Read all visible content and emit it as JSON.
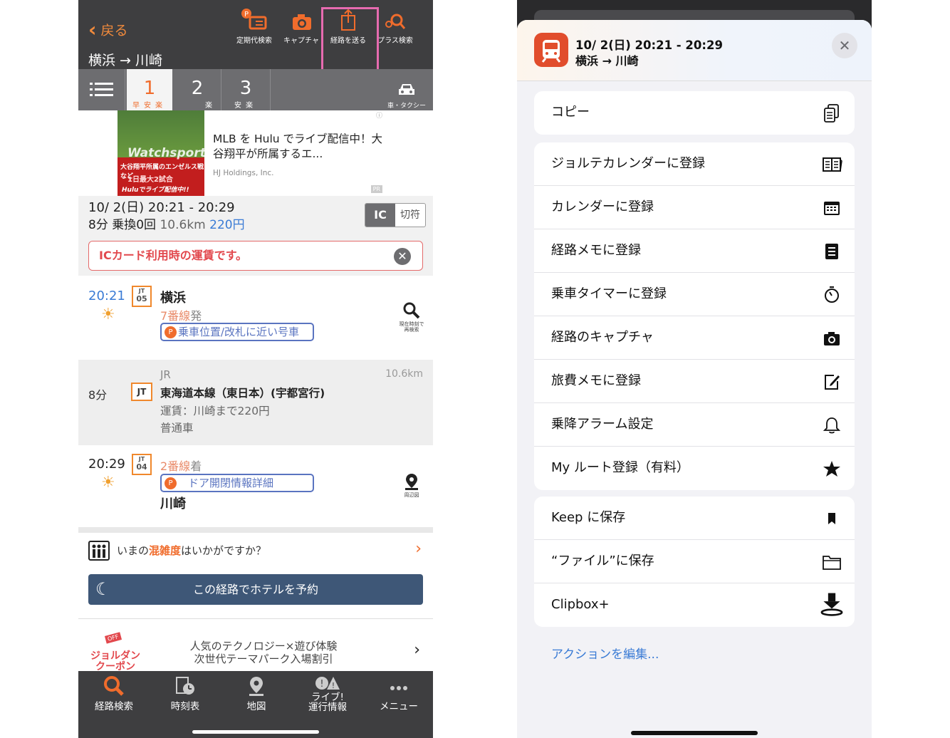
{
  "left": {
    "header": {
      "back_label": "戻る",
      "route_title": "横浜 → 川崎",
      "tools": [
        {
          "label": "定期代検索",
          "icon": "commuter-pass-icon"
        },
        {
          "label": "キャプチャ",
          "icon": "camera-icon"
        },
        {
          "label": "経路を送る",
          "icon": "share-icon"
        },
        {
          "label": "プラス検索",
          "icon": "plus-search-icon"
        }
      ]
    },
    "tabs": [
      {
        "num": "1",
        "sub": "早安楽"
      },
      {
        "num": "2",
        "sub": "楽"
      },
      {
        "num": "3",
        "sub": "安楽"
      },
      {
        "num": "",
        "sub": "車・タクシー"
      }
    ],
    "ad": {
      "image_text_1": "Watchsports!!",
      "image_text_2": "大谷翔平所属のエンゼルス戦など",
      "image_text_3": "1日最大2試合",
      "image_text_4": "Huluでライブ配信中!!",
      "headline": "MLB を Hulu でライブ配信中！大谷翔平が所属するエ...",
      "source": "HJ Holdings, Inc.",
      "pr": "PR",
      "info": "ⓘ"
    },
    "summary": {
      "datetime": "10/ 2(日) 20:21 - 20:29",
      "duration": "8分",
      "transfers": "乗換0回",
      "distance": "10.6km",
      "fare": "220円",
      "toggle_on": "IC",
      "toggle_off": "切符",
      "notice": "ICカード利用時の運賃です。"
    },
    "route": {
      "depart_time": "20:21",
      "depart_station": "横浜",
      "depart_code": "JT",
      "depart_num": "05",
      "depart_platform": "7番線",
      "depart_suffix": "発",
      "depart_pill": "乗車位置/改札に近い号車",
      "research_label": "現在時刻で再検索",
      "leg_duration": "8分",
      "leg_company": "JR",
      "leg_distance": "10.6km",
      "leg_badge": "JT",
      "leg_line": "東海道本線（東日本）(宇都宮行)",
      "leg_fare": "運賃：川崎まで220円",
      "leg_car": "普通車",
      "arrive_time": "20:29",
      "arrive_code": "JT",
      "arrive_num": "04",
      "arrive_platform": "2番線",
      "arrive_suffix": "着",
      "arrive_pill": "ドア開閉情報詳細",
      "arrive_station": "川崎",
      "map_label": "周辺図"
    },
    "crowd": {
      "prefix": "いまの",
      "highlight": "混雑度",
      "suffix": "はいかがですか？"
    },
    "hotel": "この経路でホテルを予約",
    "coupon": {
      "badge": "OFF",
      "label_1": "ジョルダン",
      "label_2": "クーポン",
      "line_1": "人気のテクノロジー×遊び体験",
      "line_2": "次世代テーマパーク入場割引"
    },
    "nav": [
      {
        "label": "経路検索",
        "icon": "route-search-icon"
      },
      {
        "label": "時刻表",
        "icon": "timetable-icon"
      },
      {
        "label": "地図",
        "icon": "map-pin-icon"
      },
      {
        "label": "ライブ!運行情報",
        "label_1": "ライブ!",
        "label_2": "運行情報",
        "icon": "live-info-icon"
      },
      {
        "label": "メニュー",
        "icon": "more-icon"
      }
    ]
  },
  "right": {
    "sheet": {
      "title": "10/ 2(日) 20:21 - 20:29",
      "subtitle": "横浜 → 川崎"
    },
    "group1": [
      {
        "label": "コピー",
        "icon": "copy-icon"
      }
    ],
    "group2": [
      {
        "label": "ジョルテカレンダーに登録",
        "icon": "jorte-calendar-icon"
      },
      {
        "label": "カレンダーに登録",
        "icon": "calendar-icon"
      },
      {
        "label": "経路メモに登録",
        "icon": "memo-icon"
      },
      {
        "label": "乗車タイマーに登録",
        "icon": "timer-icon"
      },
      {
        "label": "経路のキャプチャ",
        "icon": "camera-icon"
      },
      {
        "label": "旅費メモに登録",
        "icon": "edit-icon"
      },
      {
        "label": "乗降アラーム設定",
        "icon": "bell-icon"
      },
      {
        "label": "My ルート登録（有料）",
        "icon": "star-icon"
      }
    ],
    "group3": [
      {
        "label": "Keep に保存",
        "icon": "bookmark-icon"
      },
      {
        "label": "“ファイル”に保存",
        "icon": "folder-icon"
      },
      {
        "label": "Clipbox+",
        "icon": "download-icon"
      }
    ],
    "edit_actions": "アクションを編集..."
  }
}
